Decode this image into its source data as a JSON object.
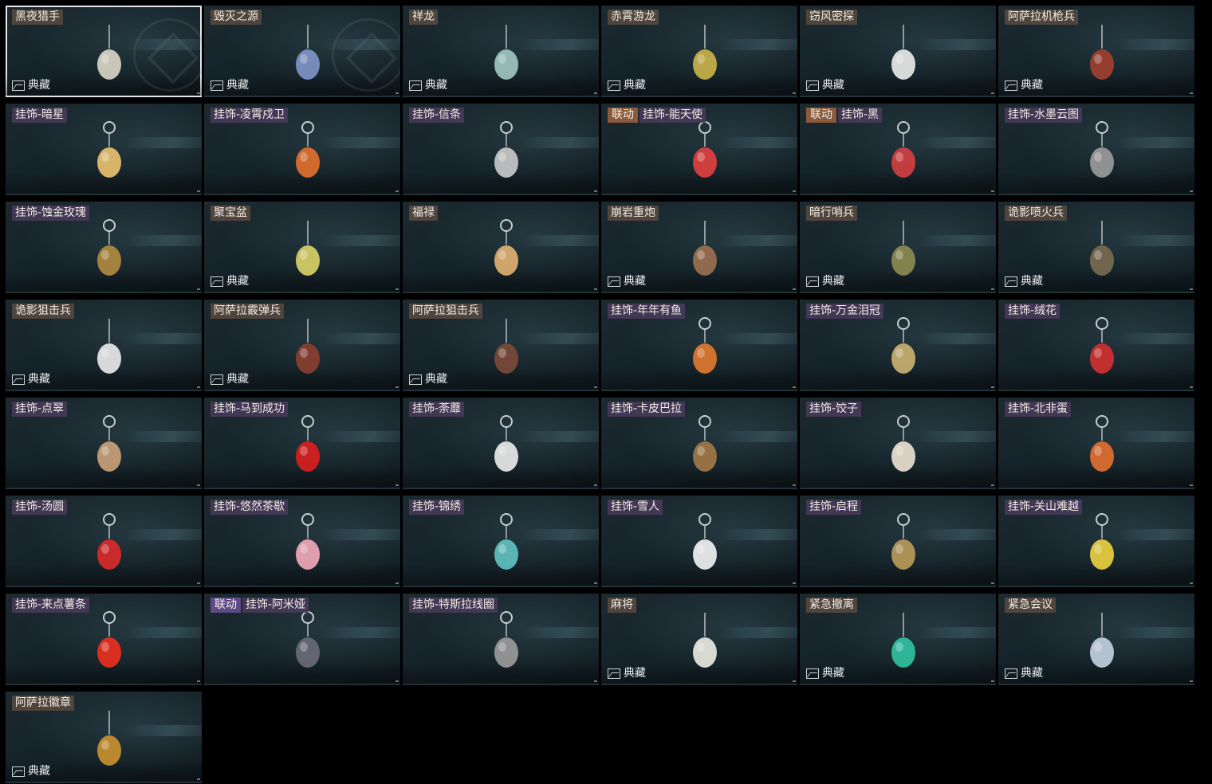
{
  "collectible_label": "典藏",
  "items": [
    {
      "name": "黑夜猎手",
      "collectible": true,
      "selected": true,
      "icon": "hunter-charm-icon",
      "color": "#d8d2c4",
      "emblem": true
    },
    {
      "name": "毁灭之源",
      "collectible": true,
      "icon": "dragon-charm-icon",
      "color": "#7f94c8",
      "emblem": true
    },
    {
      "name": "祥龙",
      "collectible": true,
      "icon": "auspicious-dragon-charm-icon",
      "color": "#9ec6c0"
    },
    {
      "name": "赤霄游龙",
      "collectible": true,
      "icon": "crimson-dragon-charm-icon",
      "color": "#c8b24a"
    },
    {
      "name": "窃风密探",
      "collectible": true,
      "icon": "spy-rabbit-charm-icon",
      "color": "#e8e8e8"
    },
    {
      "name": "阿萨拉机枪兵",
      "collectible": true,
      "icon": "machine-gunner-charm-icon",
      "color": "#a04030"
    },
    {
      "name": "挂饰-暗星",
      "icon": "dark-star-charm-icon",
      "color": "#e8c070"
    },
    {
      "name": "挂饰-凌霄戍卫",
      "icon": "rocket-charm-icon",
      "color": "#e07030"
    },
    {
      "name": "挂饰-信条",
      "icon": "creed-charm-icon",
      "color": "#c8c8c8"
    },
    {
      "name": "挂饰-能天使",
      "tag": "联动",
      "icon": "exusiai-charm-icon",
      "color": "#e04040"
    },
    {
      "name": "挂饰-黑",
      "tag": "联动",
      "icon": "schwarz-charm-icon",
      "color": "#d04040"
    },
    {
      "name": "挂饰-水墨云图",
      "icon": "ink-orb-charm-icon",
      "color": "#9a9a9a"
    },
    {
      "name": "挂饰-蚀金玫瑰",
      "icon": "gold-rose-charm-icon",
      "color": "#b08a40"
    },
    {
      "name": "聚宝盆",
      "collectible": true,
      "icon": "treasure-bowl-charm-icon",
      "color": "#d8d068"
    },
    {
      "name": "福禄",
      "icon": "gourd-charm-icon",
      "color": "#e0b070"
    },
    {
      "name": "崩岩重炮",
      "collectible": true,
      "icon": "heavy-gunner-charm-icon",
      "color": "#9a7050"
    },
    {
      "name": "暗行哨兵",
      "collectible": true,
      "icon": "sentry-charm-icon",
      "color": "#8a8a50"
    },
    {
      "name": "诡影喷火兵",
      "collectible": true,
      "icon": "flamethrower-charm-icon",
      "color": "#7a6a50"
    },
    {
      "name": "诡影狙击兵",
      "collectible": true,
      "icon": "sniper-mask-charm-icon",
      "color": "#e8e8e8"
    },
    {
      "name": "阿萨拉霰弹兵",
      "collectible": true,
      "icon": "shotgunner-charm-icon",
      "color": "#8a4030"
    },
    {
      "name": "阿萨拉狙击兵",
      "collectible": true,
      "icon": "asala-sniper-charm-icon",
      "color": "#7a4a38"
    },
    {
      "name": "挂饰-年年有鱼",
      "icon": "fish-charm-icon",
      "color": "#e07830"
    },
    {
      "name": "挂饰-万金泪冠",
      "icon": "crown-charm-icon",
      "color": "#c8b070"
    },
    {
      "name": "挂饰-绒花",
      "icon": "velvet-flower-charm-icon",
      "color": "#d03030"
    },
    {
      "name": "挂饰-点翠",
      "icon": "kingfisher-charm-icon",
      "color": "#c8a078"
    },
    {
      "name": "挂饰-马到成功",
      "icon": "horse-charm-icon",
      "color": "#d82020"
    },
    {
      "name": "挂饰-荼蘼",
      "icon": "tumi-flower-charm-icon",
      "color": "#e8e8e8"
    },
    {
      "name": "挂饰-卡皮巴拉",
      "icon": "capybara-charm-icon",
      "color": "#a07848"
    },
    {
      "name": "挂饰-饺子",
      "icon": "dumpling-charm-icon",
      "color": "#e8e0d0"
    },
    {
      "name": "挂饰-北非蛋",
      "icon": "shakshuka-charm-icon",
      "color": "#e07030"
    },
    {
      "name": "挂饰-汤圆",
      "icon": "tangyuan-charm-icon",
      "color": "#d82a2a"
    },
    {
      "name": "挂饰-悠然茶歇",
      "icon": "cupcake-charm-icon",
      "color": "#f0a8b8"
    },
    {
      "name": "挂饰-锦绣",
      "icon": "butterfly-charm-icon",
      "color": "#60c0c0"
    },
    {
      "name": "挂饰-雪人",
      "icon": "snowman-charm-icon",
      "color": "#f0f0f0"
    },
    {
      "name": "挂饰-启程",
      "icon": "compass-charm-icon",
      "color": "#b89a58"
    },
    {
      "name": "挂饰-关山难越",
      "icon": "gold-bar-charm-icon",
      "color": "#e8d040"
    },
    {
      "name": "挂饰-来点薯条",
      "icon": "fries-charm-icon",
      "color": "#e83020"
    },
    {
      "name": "挂饰-阿米娅",
      "tag": "联动",
      "tag_style": "violet",
      "icon": "amiya-charm-icon",
      "color": "#6a6a78"
    },
    {
      "name": "挂饰-特斯拉线圈",
      "icon": "tesla-coil-charm-icon",
      "color": "#9a9a9a"
    },
    {
      "name": "麻将",
      "collectible": true,
      "icon": "mahjong-charm-icon",
      "color": "#e8e8e0"
    },
    {
      "name": "紧急撤离",
      "collectible": true,
      "icon": "evac-sign-charm-icon",
      "color": "#30c0a0"
    },
    {
      "name": "紧急会议",
      "collectible": true,
      "icon": "meeting-charm-icon",
      "color": "#c0d0e0"
    },
    {
      "name": "阿萨拉徽章",
      "collectible": true,
      "icon": "asala-badge-charm-icon",
      "color": "#c89030"
    }
  ]
}
